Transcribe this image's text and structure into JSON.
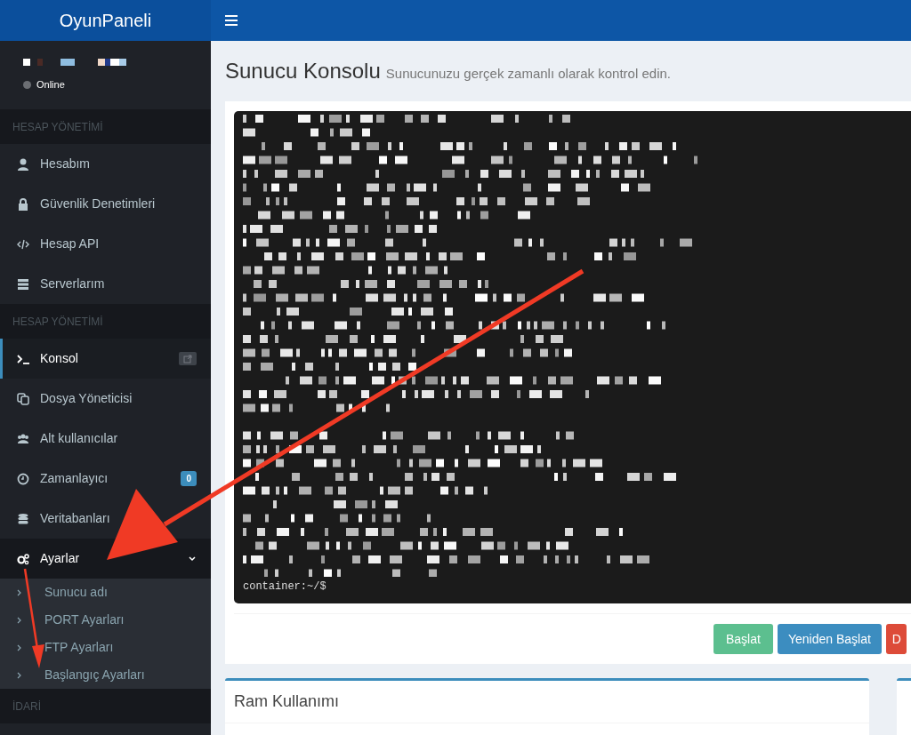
{
  "brand": "OyunPaneli",
  "user": {
    "status": "Online",
    "online": false
  },
  "sidebar": {
    "sections": [
      {
        "header": "HESAP YÖNETİMİ",
        "items": [
          {
            "label": "Hesabım",
            "selected": false
          },
          {
            "label": "Güvenlik Denetimleri",
            "selected": false
          },
          {
            "label": "Hesap API",
            "selected": false
          },
          {
            "label": "Serverlarım",
            "selected": false
          }
        ]
      },
      {
        "header": "HESAP YÖNETİMİ",
        "items": [
          {
            "label": "Konsol",
            "selected": true,
            "external": true
          },
          {
            "label": "Dosya Yöneticisi",
            "selected": false
          },
          {
            "label": "Alt kullanıcılar",
            "selected": false
          },
          {
            "label": "Zamanlayıcı",
            "selected": false,
            "badge": "0"
          },
          {
            "label": "Veritabanları",
            "selected": false
          },
          {
            "label": "Ayarlar",
            "selected": false,
            "expanded": true,
            "children": [
              {
                "label": "Sunucu adı",
                "selected": false
              },
              {
                "label": "PORT Ayarları",
                "selected": false
              },
              {
                "label": "FTP Ayarları",
                "selected": false
              },
              {
                "label": "Başlangıç Ayarları",
                "selected": false
              }
            ]
          }
        ]
      },
      {
        "header": "İDARİ"
      }
    ]
  },
  "page": {
    "title": "Sunucu Konsolu",
    "subtitle": "Sunucunuzu gerçek zamanlı olarak kontrol edin."
  },
  "console": {
    "prompt": "container:~/$"
  },
  "buttons": [
    {
      "label": "Başlat",
      "kind": "success"
    },
    {
      "label": "Yeniden Başlat",
      "kind": "primary"
    },
    {
      "label": "D",
      "kind": "danger"
    }
  ],
  "cards": [
    {
      "title": "Ram Kullanımı"
    }
  ]
}
